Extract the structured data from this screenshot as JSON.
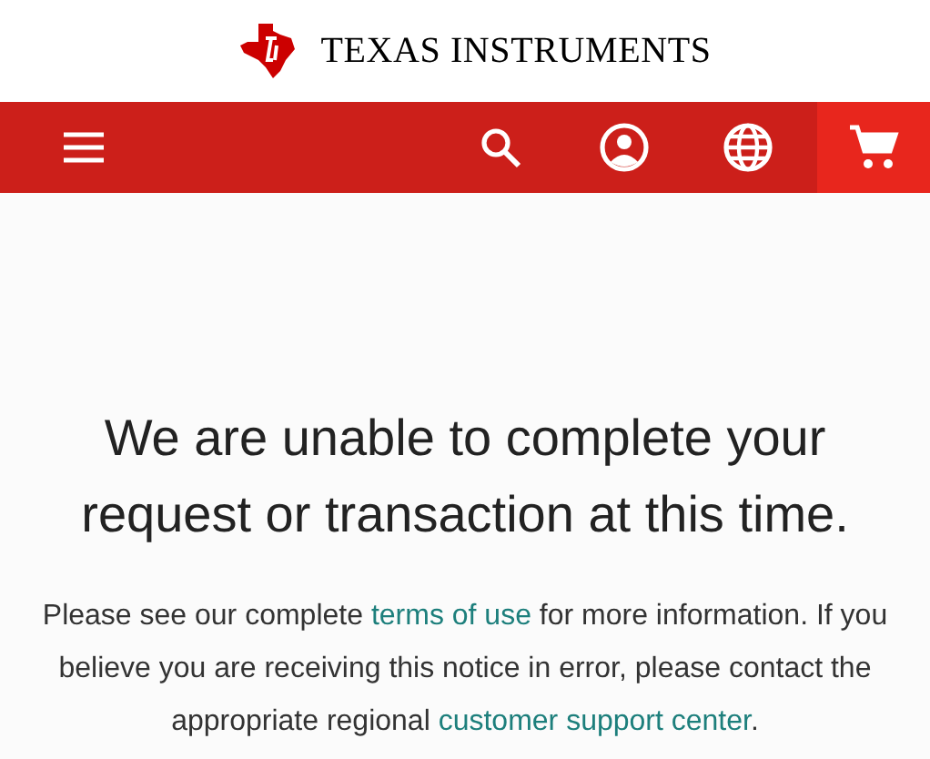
{
  "header": {
    "logo_text": "TEXAS INSTRUMENTS"
  },
  "nav": {
    "cart_active": true
  },
  "message": {
    "heading": "We are unable to complete your request or transaction at this time.",
    "paragraph": [
      {
        "kind": "text",
        "text": "Please see our complete "
      },
      {
        "kind": "link",
        "text": "terms of use"
      },
      {
        "kind": "text",
        "text": " for more information. If you believe you are receiving this notice in error, please contact the appropriate regional "
      },
      {
        "kind": "link",
        "text": "customer support center"
      },
      {
        "kind": "text",
        "text": "."
      }
    ]
  }
}
